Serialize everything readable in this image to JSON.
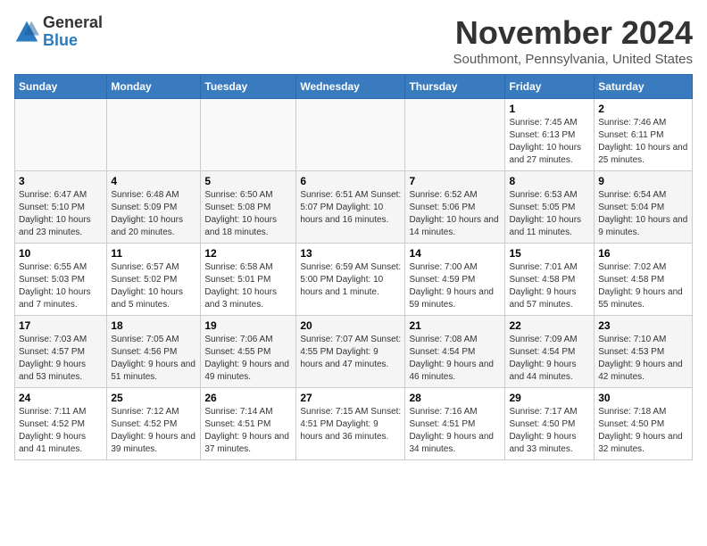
{
  "logo": {
    "general": "General",
    "blue": "Blue"
  },
  "title": "November 2024",
  "location": "Southmont, Pennsylvania, United States",
  "days_of_week": [
    "Sunday",
    "Monday",
    "Tuesday",
    "Wednesday",
    "Thursday",
    "Friday",
    "Saturday"
  ],
  "weeks": [
    [
      {
        "day": "",
        "info": ""
      },
      {
        "day": "",
        "info": ""
      },
      {
        "day": "",
        "info": ""
      },
      {
        "day": "",
        "info": ""
      },
      {
        "day": "",
        "info": ""
      },
      {
        "day": "1",
        "info": "Sunrise: 7:45 AM\nSunset: 6:13 PM\nDaylight: 10 hours and 27 minutes."
      },
      {
        "day": "2",
        "info": "Sunrise: 7:46 AM\nSunset: 6:11 PM\nDaylight: 10 hours and 25 minutes."
      }
    ],
    [
      {
        "day": "3",
        "info": "Sunrise: 6:47 AM\nSunset: 5:10 PM\nDaylight: 10 hours and 23 minutes."
      },
      {
        "day": "4",
        "info": "Sunrise: 6:48 AM\nSunset: 5:09 PM\nDaylight: 10 hours and 20 minutes."
      },
      {
        "day": "5",
        "info": "Sunrise: 6:50 AM\nSunset: 5:08 PM\nDaylight: 10 hours and 18 minutes."
      },
      {
        "day": "6",
        "info": "Sunrise: 6:51 AM\nSunset: 5:07 PM\nDaylight: 10 hours and 16 minutes."
      },
      {
        "day": "7",
        "info": "Sunrise: 6:52 AM\nSunset: 5:06 PM\nDaylight: 10 hours and 14 minutes."
      },
      {
        "day": "8",
        "info": "Sunrise: 6:53 AM\nSunset: 5:05 PM\nDaylight: 10 hours and 11 minutes."
      },
      {
        "day": "9",
        "info": "Sunrise: 6:54 AM\nSunset: 5:04 PM\nDaylight: 10 hours and 9 minutes."
      }
    ],
    [
      {
        "day": "10",
        "info": "Sunrise: 6:55 AM\nSunset: 5:03 PM\nDaylight: 10 hours and 7 minutes."
      },
      {
        "day": "11",
        "info": "Sunrise: 6:57 AM\nSunset: 5:02 PM\nDaylight: 10 hours and 5 minutes."
      },
      {
        "day": "12",
        "info": "Sunrise: 6:58 AM\nSunset: 5:01 PM\nDaylight: 10 hours and 3 minutes."
      },
      {
        "day": "13",
        "info": "Sunrise: 6:59 AM\nSunset: 5:00 PM\nDaylight: 10 hours and 1 minute."
      },
      {
        "day": "14",
        "info": "Sunrise: 7:00 AM\nSunset: 4:59 PM\nDaylight: 9 hours and 59 minutes."
      },
      {
        "day": "15",
        "info": "Sunrise: 7:01 AM\nSunset: 4:58 PM\nDaylight: 9 hours and 57 minutes."
      },
      {
        "day": "16",
        "info": "Sunrise: 7:02 AM\nSunset: 4:58 PM\nDaylight: 9 hours and 55 minutes."
      }
    ],
    [
      {
        "day": "17",
        "info": "Sunrise: 7:03 AM\nSunset: 4:57 PM\nDaylight: 9 hours and 53 minutes."
      },
      {
        "day": "18",
        "info": "Sunrise: 7:05 AM\nSunset: 4:56 PM\nDaylight: 9 hours and 51 minutes."
      },
      {
        "day": "19",
        "info": "Sunrise: 7:06 AM\nSunset: 4:55 PM\nDaylight: 9 hours and 49 minutes."
      },
      {
        "day": "20",
        "info": "Sunrise: 7:07 AM\nSunset: 4:55 PM\nDaylight: 9 hours and 47 minutes."
      },
      {
        "day": "21",
        "info": "Sunrise: 7:08 AM\nSunset: 4:54 PM\nDaylight: 9 hours and 46 minutes."
      },
      {
        "day": "22",
        "info": "Sunrise: 7:09 AM\nSunset: 4:54 PM\nDaylight: 9 hours and 44 minutes."
      },
      {
        "day": "23",
        "info": "Sunrise: 7:10 AM\nSunset: 4:53 PM\nDaylight: 9 hours and 42 minutes."
      }
    ],
    [
      {
        "day": "24",
        "info": "Sunrise: 7:11 AM\nSunset: 4:52 PM\nDaylight: 9 hours and 41 minutes."
      },
      {
        "day": "25",
        "info": "Sunrise: 7:12 AM\nSunset: 4:52 PM\nDaylight: 9 hours and 39 minutes."
      },
      {
        "day": "26",
        "info": "Sunrise: 7:14 AM\nSunset: 4:51 PM\nDaylight: 9 hours and 37 minutes."
      },
      {
        "day": "27",
        "info": "Sunrise: 7:15 AM\nSunset: 4:51 PM\nDaylight: 9 hours and 36 minutes."
      },
      {
        "day": "28",
        "info": "Sunrise: 7:16 AM\nSunset: 4:51 PM\nDaylight: 9 hours and 34 minutes."
      },
      {
        "day": "29",
        "info": "Sunrise: 7:17 AM\nSunset: 4:50 PM\nDaylight: 9 hours and 33 minutes."
      },
      {
        "day": "30",
        "info": "Sunrise: 7:18 AM\nSunset: 4:50 PM\nDaylight: 9 hours and 32 minutes."
      }
    ]
  ]
}
